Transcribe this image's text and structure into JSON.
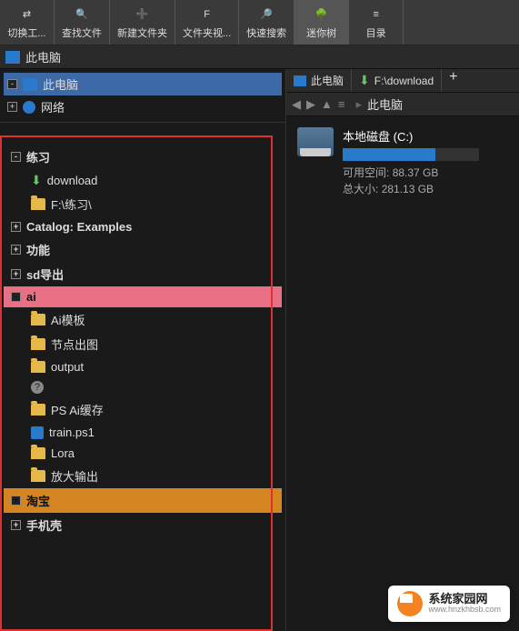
{
  "toolbar": [
    {
      "label": "切换工...",
      "icon": "swap"
    },
    {
      "label": "查找文件",
      "icon": "search"
    },
    {
      "label": "新建文件夹",
      "icon": "new-folder"
    },
    {
      "label": "文件夹视...",
      "icon": "folder-view"
    },
    {
      "label": "快速搜索",
      "icon": "quick-search"
    },
    {
      "label": "迷你树",
      "icon": "mini-tree",
      "active": true
    },
    {
      "label": "目录",
      "icon": "catalog"
    }
  ],
  "address": {
    "label": "此电脑"
  },
  "left_tree_top": [
    {
      "label": "此电脑",
      "icon": "monitor",
      "expand": "-",
      "selected": true
    },
    {
      "label": "网络",
      "icon": "network",
      "expand": "+"
    }
  ],
  "tree": [
    {
      "label": "练习",
      "exp": "-",
      "depth": 0
    },
    {
      "label": "download",
      "depth": 1,
      "icon": "download"
    },
    {
      "label": "F:\\练习\\",
      "depth": 1,
      "icon": "folder"
    },
    {
      "label": "Catalog: Examples",
      "exp": "+",
      "depth": 0
    },
    {
      "label": "功能",
      "exp": "+",
      "depth": 0
    },
    {
      "label": "sd导出",
      "exp": "+",
      "depth": 0
    },
    {
      "label": "ai",
      "exp": "-",
      "depth": 0,
      "sel": "pink"
    },
    {
      "label": "Ai模板",
      "depth": 1,
      "icon": "folder"
    },
    {
      "label": "节点出图",
      "depth": 1,
      "icon": "folder"
    },
    {
      "label": "output",
      "depth": 1,
      "icon": "folder"
    },
    {
      "label": "",
      "depth": 1,
      "icon": "help"
    },
    {
      "label": "PS Ai缓存",
      "depth": 1,
      "icon": "folder"
    },
    {
      "label": "train.ps1",
      "depth": 1,
      "icon": "ps"
    },
    {
      "label": "Lora",
      "depth": 1,
      "icon": "folder"
    },
    {
      "label": "放大输出",
      "depth": 1,
      "icon": "folder"
    },
    {
      "label": "淘宝",
      "exp": "+",
      "depth": 0,
      "sel": "orange"
    },
    {
      "label": "手机壳",
      "exp": "+",
      "depth": 0
    }
  ],
  "right_tabs": [
    {
      "label": "此电脑",
      "icon": "monitor"
    },
    {
      "label": "F:\\download",
      "icon": "download"
    }
  ],
  "breadcrumb": {
    "label": "此电脑",
    "back": "◀",
    "fwd": "▶",
    "up": "▲",
    "list": "≡"
  },
  "drive": {
    "name": "本地磁盘 (C:)",
    "free_label": "可用空间:",
    "free_val": "88.37 GB",
    "total_label": "总大小:",
    "total_val": "281.13 GB"
  },
  "watermark": {
    "title": "系统家园网",
    "url": "www.hnzkhbsb.com"
  }
}
